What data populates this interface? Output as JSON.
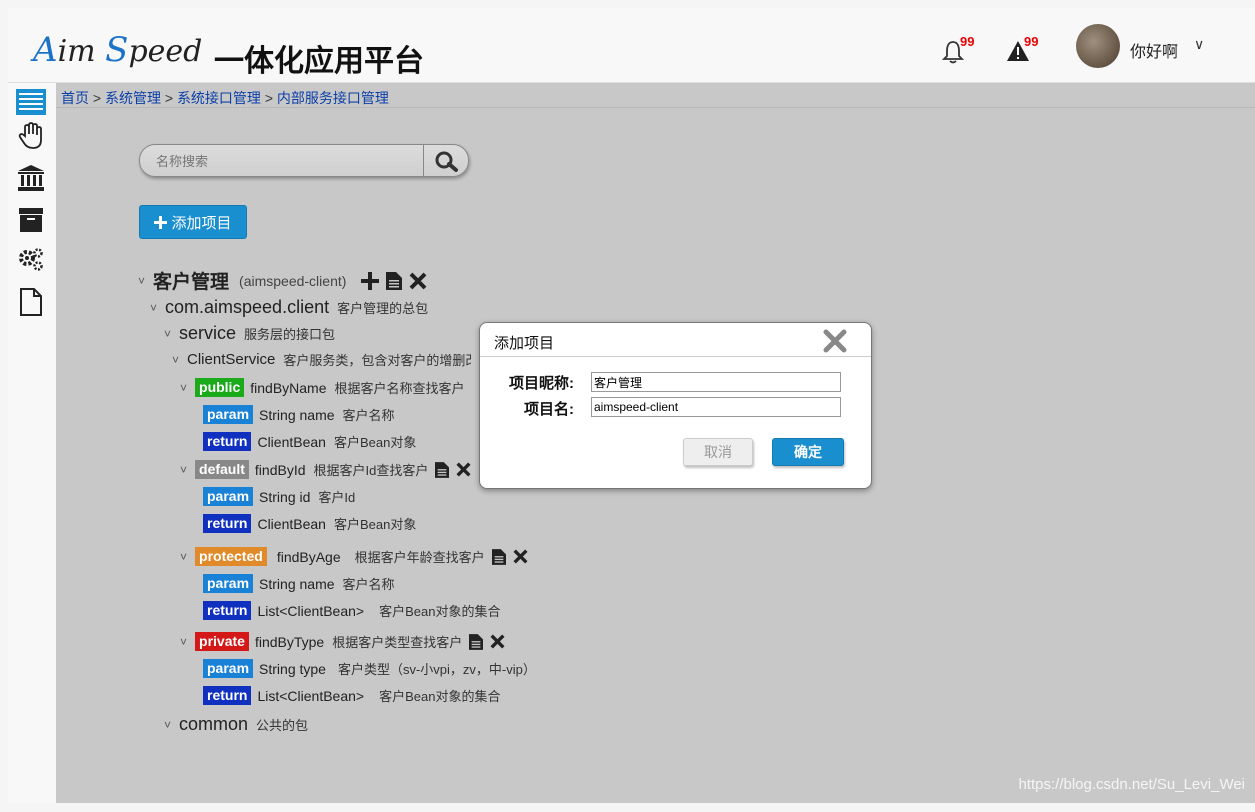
{
  "header": {
    "logo_cap1": "A",
    "logo_rest1": "im ",
    "logo_cap2": "S",
    "logo_rest2": "peed",
    "app_title": "一体化应用平台",
    "bell_badge": "99",
    "alert_badge": "99",
    "username": "你好啊",
    "caret": "∨"
  },
  "breadcrumb": {
    "items": [
      "首页",
      "系统管理",
      "系统接口管理",
      "内部服务接口管理"
    ],
    "sep": " > "
  },
  "search": {
    "placeholder": "名称搜索"
  },
  "add_button": {
    "label": "添加项目"
  },
  "tree": {
    "toggle": "˅",
    "project": {
      "name": "客户管理",
      "code": "(aimspeed-client)"
    },
    "package": {
      "name": "com.aimspeed.client",
      "desc": "客户管理的总包"
    },
    "service_pkg": {
      "name": "service",
      "desc": "服务层的接口包"
    },
    "service_class": {
      "name": "ClientService",
      "desc": "客户服务类，包含对客户的增删改"
    },
    "methods": [
      {
        "modifier": "public",
        "name": "findByName",
        "desc": "根据客户名称查找客户",
        "param": {
          "tag": "param",
          "type": "String name",
          "desc": "客户名称"
        },
        "ret": {
          "tag": "return",
          "type": "ClientBean",
          "desc": "客户Bean对象"
        }
      },
      {
        "modifier": "default",
        "name": "findById",
        "desc": "根据客户Id查找客户",
        "param": {
          "tag": "param",
          "type": "String id",
          "desc": "客户Id"
        },
        "ret": {
          "tag": "return",
          "type": "ClientBean",
          "desc": "客户Bean对象"
        }
      },
      {
        "modifier": "protected",
        "name": "findByAge",
        "desc": "根据客户年龄查找客户",
        "param": {
          "tag": "param",
          "type": "String name",
          "desc": "客户名称"
        },
        "ret": {
          "tag": "return",
          "type": "List<ClientBean>",
          "desc": "客户Bean对象的集合"
        }
      },
      {
        "modifier": "private",
        "name": "findByType",
        "desc": "根据客户类型查找客户",
        "param": {
          "tag": "param",
          "type": "String type",
          "desc": "客户类型（sv-小vpi，zv，中-vip）"
        },
        "ret": {
          "tag": "return",
          "type": "List<ClientBean>",
          "desc": "客户Bean对象的集合"
        }
      }
    ],
    "common_pkg": {
      "name": "common",
      "desc": "公共的包"
    }
  },
  "dialog": {
    "title": "添加项目",
    "nickname_label": "项目昵称:",
    "nickname_value": "客户管理",
    "name_label": "项目名:",
    "name_value": "aimspeed-client",
    "cancel": "取消",
    "ok": "确定"
  },
  "watermark": "https://blog.csdn.net/Su_Levi_Wei",
  "colors": {
    "accent": "#1a8fd0",
    "public": "#1aaa1a",
    "default": "#888888",
    "protected": "#e08a2a",
    "private": "#d41818",
    "param": "#1a82d6",
    "return": "#1030c0"
  }
}
